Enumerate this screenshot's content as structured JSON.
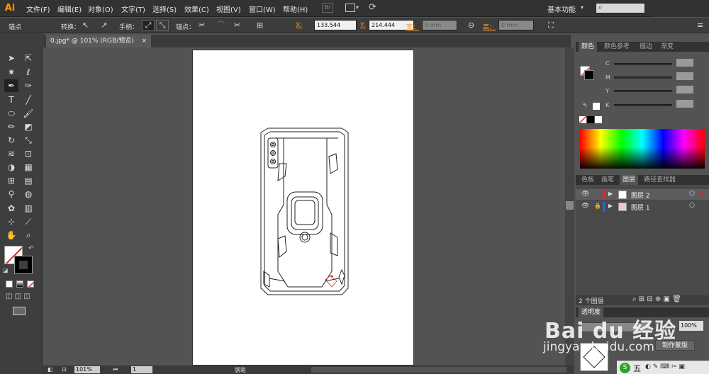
{
  "app": {
    "logo": "Ai",
    "workspace": "基本功能",
    "workspace_arrow": "▾"
  },
  "menu": [
    "文件(F)",
    "编辑(E)",
    "对象(O)",
    "文字(T)",
    "选择(S)",
    "效果(C)",
    "视图(V)",
    "窗口(W)",
    "帮助(H)"
  ],
  "control": {
    "context": "锚点",
    "convert_label": "转换：",
    "handles_label": "手柄：",
    "anchors_label": "锚点：",
    "x_label": "X:",
    "x_value": "133.544",
    "y_label": "Y:",
    "y_value": "214.444",
    "w_label": "宽：",
    "w_value": "0 mm",
    "h_label": "高：",
    "h_value": "0 mm"
  },
  "document": {
    "tab_title": "0.jpg* @ 101% (RGB/预览)",
    "close": "×"
  },
  "status": {
    "zoom": "101%",
    "page": "1",
    "tool": "钢笔"
  },
  "color_panel": {
    "tabs": [
      "颜色",
      "颜色参考",
      "描边",
      "渐变"
    ],
    "channels": [
      "C",
      "M",
      "Y",
      "K"
    ]
  },
  "layers_panel": {
    "tabs": [
      "色板",
      "画笔",
      "图层",
      "路径查找器"
    ],
    "layers": [
      {
        "name": "图层 2",
        "color": "#e0252c"
      },
      {
        "name": "图层 1",
        "color": "#3a5bd8"
      }
    ],
    "count": "2 个图层"
  },
  "transparency_panel": {
    "tab": "透明度",
    "opacity": "100%",
    "make_mask": "制作蒙版"
  },
  "watermark": {
    "brand": "Bai du 经验",
    "url": "jingyan.baidu.com"
  },
  "taskbar": {
    "ime": "五",
    "items": "◐ ✎ ⌨ ✂ ▣"
  },
  "colors": {
    "accent": "#ff9a2e",
    "menubar": "#323232",
    "panel": "#535353"
  }
}
